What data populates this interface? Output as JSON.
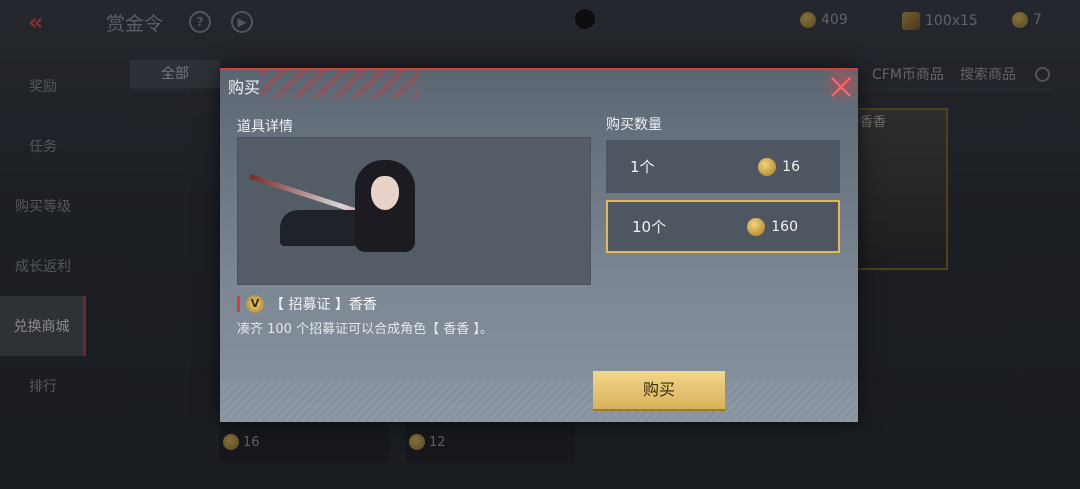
{
  "header": {
    "title": "赏金令",
    "currencies": [
      {
        "name": "coin",
        "value": "409"
      },
      {
        "name": "bounty-token",
        "value": "100x15"
      },
      {
        "name": "gold-coin",
        "value": "7"
      }
    ]
  },
  "sidebar": {
    "items": [
      {
        "label": "奖励"
      },
      {
        "label": "任务"
      },
      {
        "label": "购买等级"
      },
      {
        "label": "成长返利"
      },
      {
        "label": "兑换商城"
      },
      {
        "label": "排行"
      }
    ],
    "active": "兑换商城"
  },
  "tabs": {
    "all": "全部",
    "cfm": "CFM币商品",
    "search": "搜索商品"
  },
  "background_cards": {
    "right_label": "香香",
    "bottom": [
      {
        "price": "16"
      },
      {
        "price": "12"
      }
    ]
  },
  "modal": {
    "title": "购买",
    "details_label": "道具详情",
    "quantity_label": "购买数量",
    "item_name": "【 招募证 】香香",
    "item_description": "凑齐 100 个招募证可以合成角色【 香香 】。",
    "options": [
      {
        "qty": "1个",
        "price": "16",
        "selected": false
      },
      {
        "qty": "10个",
        "price": "160",
        "selected": true
      }
    ],
    "buy_label": "购买"
  },
  "colors": {
    "accent_red": "#d34040",
    "selected_border": "#e1b95a",
    "buy_button": "#e5c473"
  }
}
